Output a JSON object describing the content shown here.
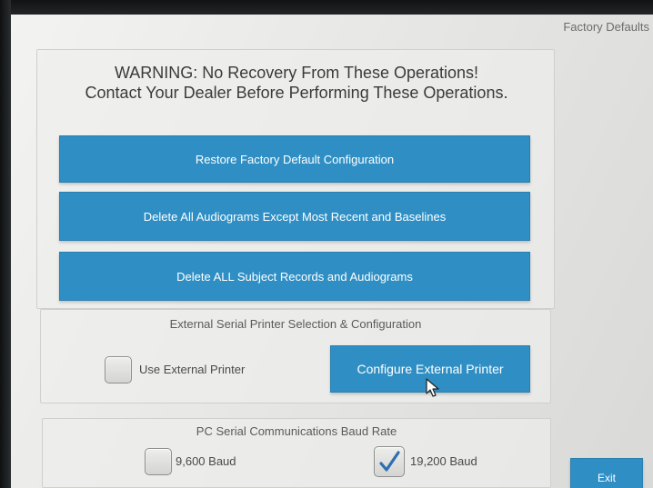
{
  "window": {
    "title": "Factory Defaults"
  },
  "warning": {
    "line1": "WARNING: No Recovery From These Operations!",
    "line2": "Contact Your Dealer Before Performing These Operations."
  },
  "actions": {
    "restore_label": "Restore Factory Default Configuration",
    "delete_audiograms_label": "Delete All Audiograms Except Most Recent and Baselines",
    "delete_all_label": "Delete ALL Subject Records and Audiograms"
  },
  "printer": {
    "section_label": "External Serial Printer Selection & Configuration",
    "use_external_label": "Use External Printer",
    "use_external_checked": false,
    "configure_label": "Configure External Printer"
  },
  "baud": {
    "section_label": "PC Serial Communications Baud Rate",
    "options": [
      {
        "label": "9,600 Baud",
        "checked": false
      },
      {
        "label": "19,200 Baud",
        "checked": true
      }
    ]
  },
  "exit_label": "Exit",
  "colors": {
    "button": "#2f8fc4",
    "checkmark": "#2f6fb0"
  },
  "icons": {
    "checkmark": "checkmark-icon",
    "cursor": "mouse-cursor-icon"
  }
}
